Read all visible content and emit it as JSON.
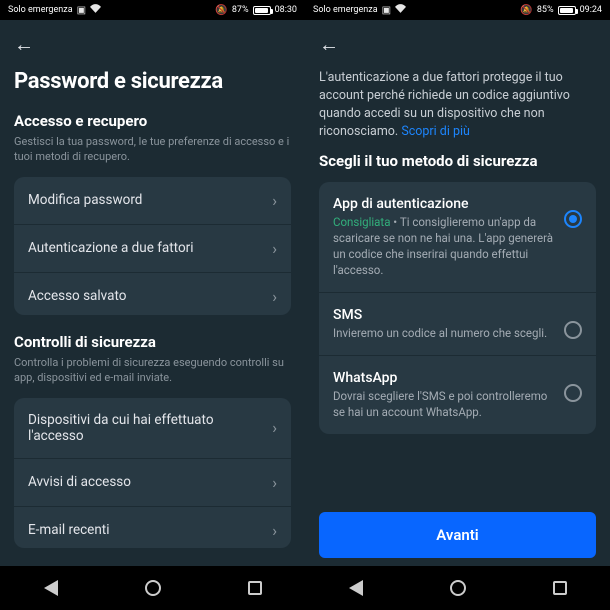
{
  "left": {
    "status": {
      "carrier": "Solo emergenza",
      "battery_pct": "87%",
      "battery_fill": "87%",
      "time": "08:30"
    },
    "title": "Password e sicurezza",
    "section1": {
      "title": "Accesso e recupero",
      "sub": "Gestisci la tua password, le tue preferenze di accesso e i tuoi metodi di recupero.",
      "items": [
        "Modifica password",
        "Autenticazione a due fattori",
        "Accesso salvato"
      ]
    },
    "section2": {
      "title": "Controlli di sicurezza",
      "sub": "Controlla i problemi di sicurezza eseguendo controlli su app, dispositivi ed e-mail inviate.",
      "items": [
        "Dispositivi da cui hai effettuato l'accesso",
        "Avvisi di accesso",
        "E-mail recenti"
      ]
    }
  },
  "right": {
    "status": {
      "carrier": "Solo emergenza",
      "battery_pct": "85%",
      "battery_fill": "85%",
      "time": "09:24"
    },
    "intro": "L'autenticazione a due fattori protegge il tuo account perché richiede un codice aggiuntivo quando accedi su un dispositivo che non riconosciamo. ",
    "intro_link": "Scopri di più",
    "choose_title": "Scegli il tuo metodo di sicurezza",
    "methods": [
      {
        "name": "App di autenticazione",
        "recommended": "Consigliata",
        "sep": "  •  ",
        "desc": "Ti consiglieremo un'app da scaricare se non ne hai una. L'app genererà un codice che inserirai quando effettui l'accesso.",
        "selected": true
      },
      {
        "name": "SMS",
        "desc": "Invieremo un codice al numero che scegli.",
        "selected": false
      },
      {
        "name": "WhatsApp",
        "desc": "Dovrai scegliere l'SMS e poi controlleremo se hai un account WhatsApp.",
        "selected": false
      }
    ],
    "next_btn": "Avanti"
  }
}
